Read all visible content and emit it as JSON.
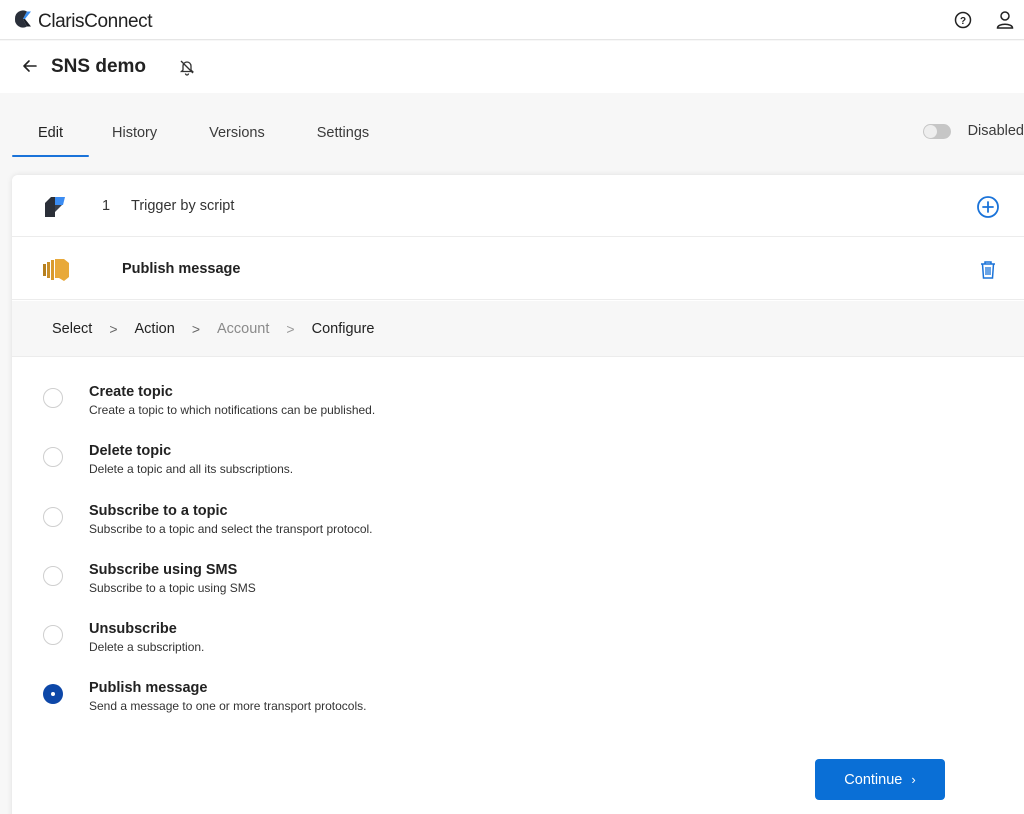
{
  "app": {
    "brand_bold": "Claris",
    "brand_light": "Connect"
  },
  "header": {
    "title": "SNS demo",
    "icons": [
      "help-icon",
      "user-icon",
      "back-arrow-icon",
      "bell-off-icon"
    ]
  },
  "tabs": [
    {
      "label": "Edit",
      "active": true
    },
    {
      "label": "History",
      "active": false
    },
    {
      "label": "Versions",
      "active": false
    },
    {
      "label": "Settings",
      "active": false
    }
  ],
  "status_toggle": {
    "label": "Disabled",
    "on": false
  },
  "steps": [
    {
      "number": "1",
      "label": "Trigger by script",
      "icon": "filemaker-icon",
      "action_icon": "add-circle-icon"
    },
    {
      "number": "",
      "label": "Publish message",
      "icon": "aws-sns-icon",
      "action_icon": "trash-icon"
    }
  ],
  "breadcrumb": [
    {
      "label": "Select",
      "dim": false
    },
    {
      "label": "Action",
      "dim": false
    },
    {
      "label": "Account",
      "dim": true
    },
    {
      "label": "Configure",
      "dim": false
    }
  ],
  "actions": [
    {
      "title": "Create topic",
      "description": "Create a topic to which notifications can be published.",
      "selected": false
    },
    {
      "title": "Delete topic",
      "description": "Delete a topic and all its subscriptions.",
      "selected": false
    },
    {
      "title": "Subscribe to a topic",
      "description": "Subscribe to a topic and select the transport protocol.",
      "selected": false
    },
    {
      "title": "Subscribe using SMS",
      "description": "Subscribe to a topic using SMS",
      "selected": false
    },
    {
      "title": "Unsubscribe",
      "description": "Delete a subscription.",
      "selected": false
    },
    {
      "title": "Publish message",
      "description": "Send a message to one or more transport protocols.",
      "selected": true
    }
  ],
  "continue_button": {
    "label": "Continue",
    "arrow": "›"
  },
  "colors": {
    "accent": "#1a73d9",
    "button": "#0a6fd6",
    "radio_selected": "#0d47a8",
    "aws_orange": "#e8a93a"
  }
}
